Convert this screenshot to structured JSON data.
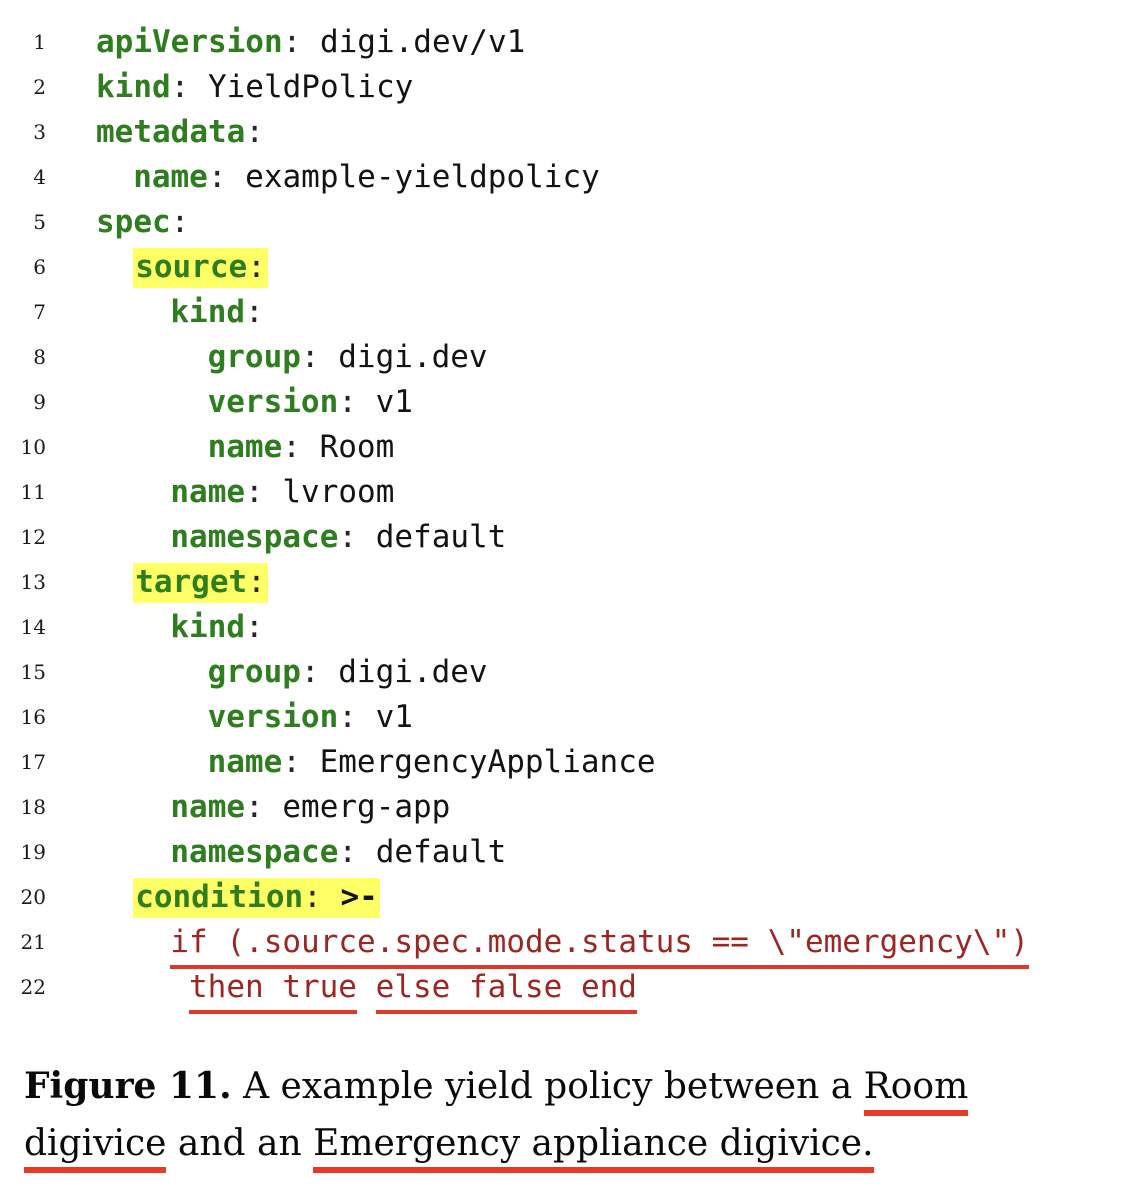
{
  "document": {
    "type": "figure-code-listing",
    "colors": {
      "key_green": "#2e7d1e",
      "highlight_yellow": "#ffff66",
      "jq_red_text": "#9c2622",
      "underline_red": "#e0392c",
      "caption_underline_red": "#ea3a25",
      "value_black": "#131313",
      "page_background": "#ffffff"
    }
  },
  "listing": {
    "language": "yaml",
    "lines": [
      {
        "number": "1",
        "indent": 0,
        "highlight": false,
        "key": "apiVersion",
        "sep": ": ",
        "value": "digi.dev/v1"
      },
      {
        "number": "2",
        "indent": 0,
        "highlight": false,
        "key": "kind",
        "sep": ": ",
        "value": "YieldPolicy"
      },
      {
        "number": "3",
        "indent": 0,
        "highlight": false,
        "key": "metadata",
        "sep": ":",
        "value": ""
      },
      {
        "number": "4",
        "indent": 2,
        "highlight": false,
        "key": "name",
        "sep": ": ",
        "value": "example-yieldpolicy"
      },
      {
        "number": "5",
        "indent": 0,
        "highlight": false,
        "key": "spec",
        "sep": ":",
        "value": ""
      },
      {
        "number": "6",
        "indent": 2,
        "highlight": true,
        "key": "source",
        "sep": ":",
        "value": ""
      },
      {
        "number": "7",
        "indent": 4,
        "highlight": false,
        "key": "kind",
        "sep": ":",
        "value": ""
      },
      {
        "number": "8",
        "indent": 6,
        "highlight": false,
        "key": "group",
        "sep": ": ",
        "value": "digi.dev"
      },
      {
        "number": "9",
        "indent": 6,
        "highlight": false,
        "key": "version",
        "sep": ": ",
        "value": "v1"
      },
      {
        "number": "10",
        "indent": 6,
        "highlight": false,
        "key": "name",
        "sep": ": ",
        "value": "Room"
      },
      {
        "number": "11",
        "indent": 4,
        "highlight": false,
        "key": "name",
        "sep": ": ",
        "value": "lvroom"
      },
      {
        "number": "12",
        "indent": 4,
        "highlight": false,
        "key": "namespace",
        "sep": ": ",
        "value": "default"
      },
      {
        "number": "13",
        "indent": 2,
        "highlight": true,
        "key": "target",
        "sep": ":",
        "value": ""
      },
      {
        "number": "14",
        "indent": 4,
        "highlight": false,
        "key": "kind",
        "sep": ":",
        "value": ""
      },
      {
        "number": "15",
        "indent": 6,
        "highlight": false,
        "key": "group",
        "sep": ": ",
        "value": "digi.dev"
      },
      {
        "number": "16",
        "indent": 6,
        "highlight": false,
        "key": "version",
        "sep": ": ",
        "value": "v1"
      },
      {
        "number": "17",
        "indent": 6,
        "highlight": false,
        "key": "name",
        "sep": ": ",
        "value": "EmergencyAppliance"
      },
      {
        "number": "18",
        "indent": 4,
        "highlight": false,
        "key": "name",
        "sep": ": ",
        "value": "emerg-app"
      },
      {
        "number": "19",
        "indent": 4,
        "highlight": false,
        "key": "namespace",
        "sep": ": ",
        "value": "default"
      },
      {
        "number": "20",
        "indent": 2,
        "highlight": true,
        "key": "condition",
        "sep": ": ",
        "value": ">-",
        "value_is_block_scalar": true
      }
    ],
    "expression_lines": [
      {
        "number": "21",
        "indent": 4,
        "segments": [
          {
            "text": "if (.source.spec.mode.status == \\\"emergency\\\")",
            "underlined": true
          }
        ]
      },
      {
        "number": "22",
        "indent": 5,
        "segments": [
          {
            "text": "then true",
            "underlined": true
          },
          {
            "text": " ",
            "underlined": false
          },
          {
            "text": "else false end",
            "underlined": true
          }
        ]
      }
    ]
  },
  "caption": {
    "label": "Figure 11.",
    "part1": " A example yield policy between a ",
    "underlined1": "Room digivice",
    "part2": " and an ",
    "underlined2": "Emergency appliance digivice.",
    "full_text": "Figure 11. A example yield policy between a Room digivice and an Emergency appliance digivice."
  }
}
